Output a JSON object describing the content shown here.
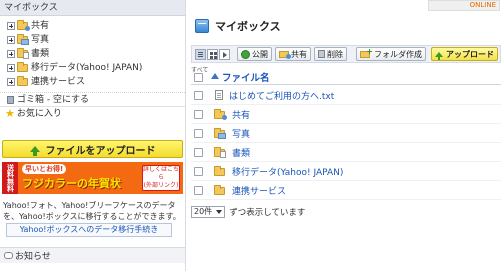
{
  "sidebar": {
    "header": "マイボックス",
    "tree": [
      {
        "label": "共有",
        "icon": "shared-folder-icon"
      },
      {
        "label": "写真",
        "icon": "photo-folder-icon"
      },
      {
        "label": "書類",
        "icon": "document-folder-icon"
      },
      {
        "label": "移行データ(Yahoo! JAPAN)",
        "icon": "folder-icon"
      },
      {
        "label": "連携サービス",
        "icon": "folder-icon"
      }
    ],
    "trash_label": "ゴミ箱 - 空にする",
    "favorites_label": "お気に入り",
    "upload_button": "ファイルをアップロード",
    "banner": {
      "tag": "送料無料",
      "sub": "早いとお得!",
      "title": "フジカラーの年賀状",
      "cta_line1": "詳しくはこちら",
      "cta_line2": "(外部リンク)"
    },
    "migrate_text": "Yahoo!フォト、Yahoo!ブリーフケースのデータを、Yahoo!ボックスに移行することができます。",
    "migrate_link": "Yahoo!ボックスへのデータ移行手続き",
    "notice_label": "お知らせ"
  },
  "main": {
    "title": "マイボックス",
    "topright": "ONLINE",
    "toolbar": {
      "public": "公開",
      "share": "共有",
      "delete": "削除",
      "folder_create": "フォルダ作成",
      "upload": "アップロード"
    },
    "column_header": {
      "all": "すべて",
      "name": "ファイル名"
    },
    "files": [
      {
        "name": "はじめてご利用の方へ.txt",
        "icon": "text-file-icon"
      },
      {
        "name": "共有",
        "icon": "shared-folder-icon"
      },
      {
        "name": "写真",
        "icon": "photo-folder-icon"
      },
      {
        "name": "書類",
        "icon": "document-folder-icon"
      },
      {
        "name": "移行データ(Yahoo! JAPAN)",
        "icon": "folder-icon"
      },
      {
        "name": "連携サービス",
        "icon": "folder-icon"
      }
    ],
    "pager": {
      "per_page": "20件",
      "suffix": "ずつ表示しています"
    }
  },
  "colors": {
    "link": "#1a55b8",
    "upload_yellow": "#f4dc2e",
    "sidebar_header": "#e6eaf0"
  }
}
